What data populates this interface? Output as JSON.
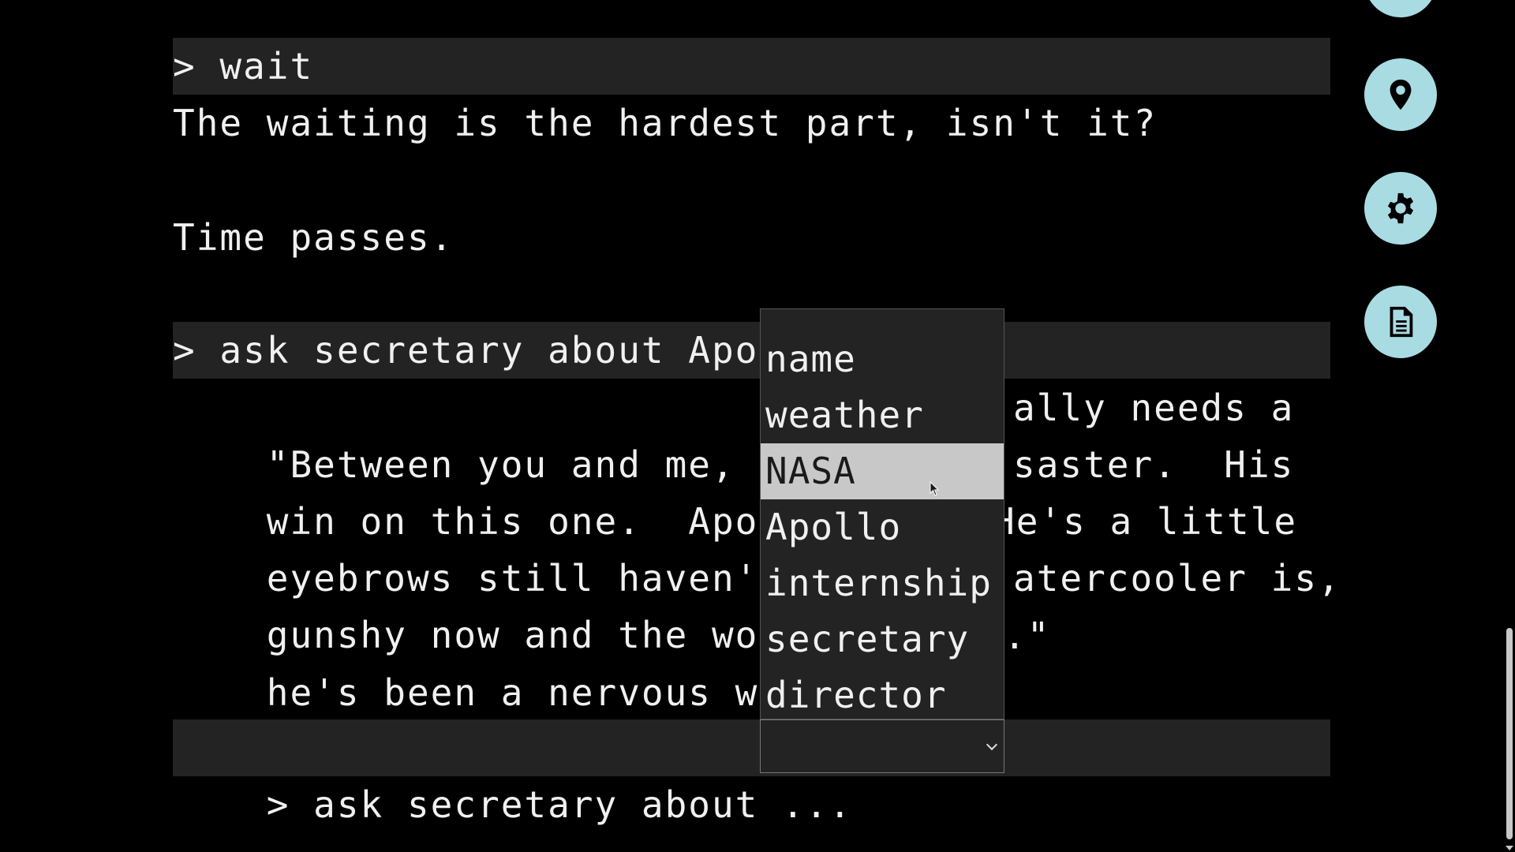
{
  "transcript": {
    "cmd_wait": "> wait",
    "resp_wait": "The waiting is the hardest part, isn't it?",
    "time_passes": "Time passes.",
    "cmd_ask_partial": "> ask secretary about Apol",
    "resp_lines": [
      "\"Between you and me, the d",
      "ally needs a",
      "win on this one.  Apollo 1",
      "saster.  His",
      "eyebrows still haven't gro",
      "He's a little",
      "gunshy now and the word ar",
      "atercooler is,",
      "he's been a nervous wreck",
      ".\""
    ],
    "prompt": "> ask secretary about ..."
  },
  "dropdown": {
    "options": [
      "name",
      "weather",
      "NASA",
      "Apollo",
      "internship",
      "secretary",
      "director"
    ],
    "selected": "NASA",
    "current_value": ""
  },
  "side_buttons": [
    {
      "icon": "map-pin-icon"
    },
    {
      "icon": "gear-icon"
    },
    {
      "icon": "document-icon"
    }
  ],
  "colors": {
    "background": "#000000",
    "command_band": "#232323",
    "button": "#a9dbe3",
    "selected_option": "#c8c8c8"
  }
}
